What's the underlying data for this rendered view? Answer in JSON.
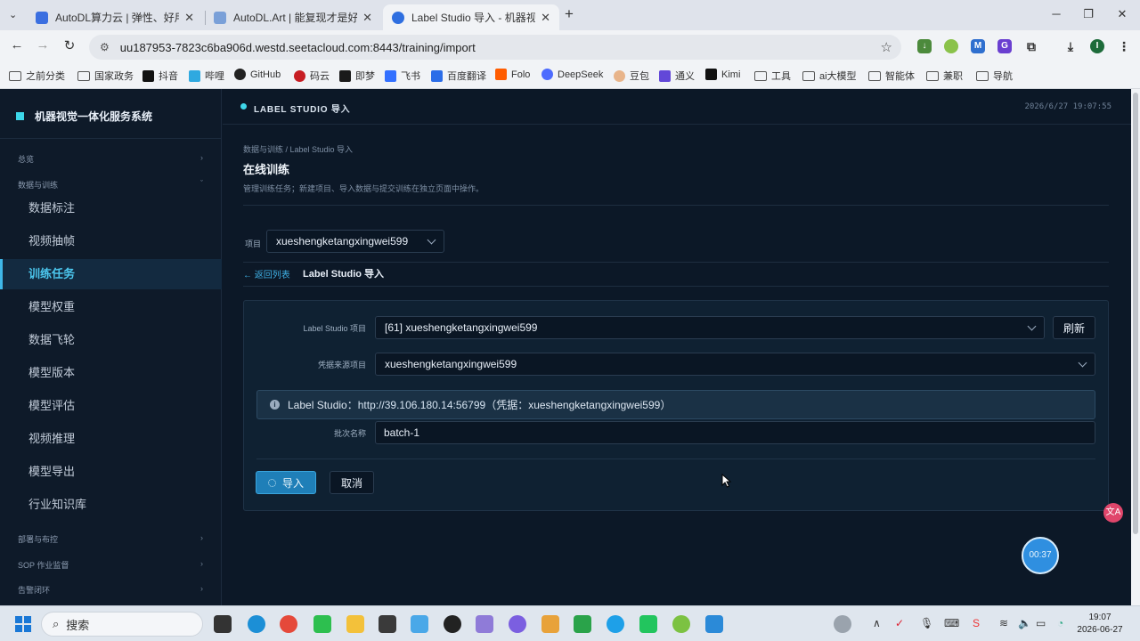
{
  "browser": {
    "tabs": [
      {
        "title": "AutoDL算力云 | 弹性、好用、",
        "active": false,
        "color": "#3b6fe0"
      },
      {
        "title": "AutoDL.Art | 能复现才是好算",
        "active": false,
        "color": "#7aa0d8"
      },
      {
        "title": "Label Studio 导入 - 机器视觉",
        "active": true,
        "color": "#2f6fe0"
      }
    ],
    "new_tab": "+",
    "url": "uu187953-7823c6ba906d.westd.seetacloud.com:8443/training/import",
    "profile_initial": "I",
    "bookmarks": [
      "之前分类",
      "国家政务",
      "抖音",
      "哔哩",
      "GitHub",
      "码云",
      "即梦",
      "飞书",
      "百度翻译",
      "Folo",
      "DeepSeek",
      "豆包",
      "通义",
      "Kimi",
      "工具",
      "ai大模型",
      "智能体",
      "兼职",
      "导航"
    ]
  },
  "app": {
    "brand": "机器视觉一体化服务系统",
    "header_title": "LABEL STUDIO 导入",
    "datetime": "2026/6/27 19:07:55",
    "sidebar": {
      "groups": {
        "overview": "总览",
        "data_train": "数据与训练",
        "deploy": "部署与布控",
        "sop": "SOP 作业监督",
        "alarm": "告警闭环"
      },
      "items": [
        "数据标注",
        "视频抽帧",
        "训练任务",
        "模型权重",
        "数据飞轮",
        "模型版本",
        "模型评估",
        "视频推理",
        "模型导出",
        "行业知识库"
      ],
      "active_index": 2
    },
    "breadcrumb": "数据与训练 / Label Studio 导入",
    "page_title": "在线训练",
    "page_desc": "管理训练任务；新建项目、导入数据与提交训练在独立页面中操作。",
    "project_label": "项目",
    "project_value": "xueshengketangxingwei599",
    "back_label": "← 返回列表",
    "sub_title": "Label Studio 导入",
    "form": {
      "ls_project_label": "Label Studio 项目",
      "ls_project_value": "[61] xueshengketangxingwei599",
      "refresh_label": "刷新",
      "cred_label": "凭据来源项目",
      "cred_value": "xueshengketangxingwei599",
      "alert_prefix": "Label Studio：",
      "alert_url": "http://39.106.180.14:56799",
      "alert_suffix": "（凭据：xueshengketangxingwei599）",
      "batch_label": "批次名称",
      "batch_value": "batch-1",
      "import_label": "导入",
      "cancel_label": "取消"
    },
    "timer": "00:37",
    "translate_icon": "文A"
  },
  "taskbar": {
    "search": "搜索",
    "time": "19:07",
    "date": "2026-06-27"
  }
}
